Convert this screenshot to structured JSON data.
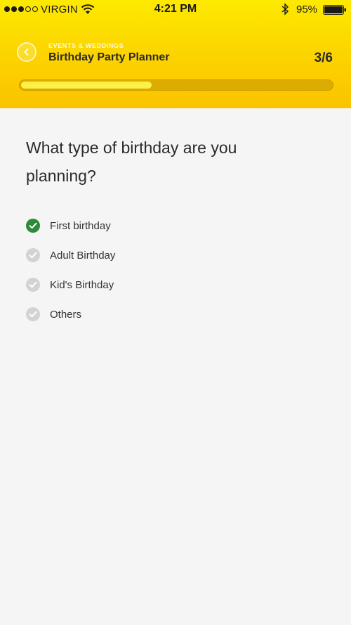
{
  "status_bar": {
    "carrier": "VIRGIN",
    "time": "4:21 PM",
    "battery": "95%"
  },
  "header": {
    "category": "EVENTS & WEDDINGS",
    "title": "Birthday Party Planner",
    "step": "3/6",
    "progress": 0.42
  },
  "question": "What type of birthday are you planning?",
  "options": [
    {
      "label": "First birthday",
      "selected": true
    },
    {
      "label": "Adult Birthday",
      "selected": false
    },
    {
      "label": "Kid's Birthday",
      "selected": false
    },
    {
      "label": "Others",
      "selected": false
    }
  ],
  "colors": {
    "header_top": "#fde900",
    "header_bottom": "#fbc300",
    "selected_check": "#2e8a3a",
    "unselected_check": "#d3d3d3",
    "background": "#f5f5f5"
  },
  "icons": {
    "back": "chevron-left-icon",
    "check": "check-icon",
    "wifi": "wifi-icon",
    "bluetooth": "bluetooth-icon",
    "battery": "battery-icon"
  }
}
